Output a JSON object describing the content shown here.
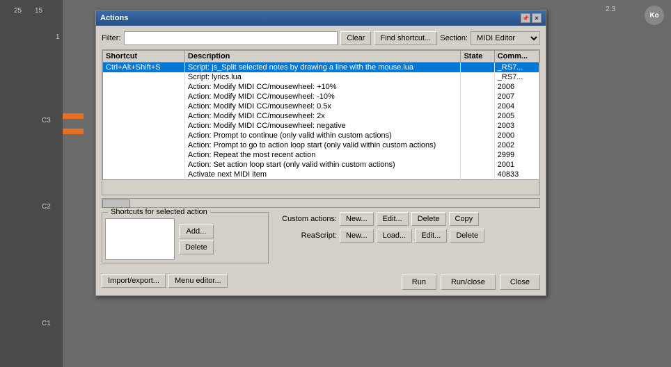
{
  "daw": {
    "markers": {
      "top_left_1": "25",
      "top_left_2": "15",
      "side_num": "1",
      "c3": "C3",
      "c2": "C2",
      "c1": "C1",
      "top_right": "2.3",
      "ko": "Ko"
    }
  },
  "modal": {
    "title": "Actions",
    "filter_label": "Filter:",
    "filter_value": "",
    "clear_label": "Clear",
    "find_shortcut_label": "Find shortcut...",
    "section_label": "Section:",
    "section_value": "MIDI Editor",
    "columns": {
      "shortcut": "Shortcut",
      "description": "Description",
      "state": "State",
      "command": "Comm..."
    },
    "rows": [
      {
        "shortcut": "Ctrl+Alt+Shift+S",
        "description": "Script: js_Split selected notes by drawing a line with the mouse.lua",
        "state": "",
        "command": "_RS7..."
      },
      {
        "shortcut": "",
        "description": "Script: lyrics.lua",
        "state": "",
        "command": "_RS7..."
      },
      {
        "shortcut": "",
        "description": "Action: Modify MIDI CC/mousewheel: +10%",
        "state": "",
        "command": "2006"
      },
      {
        "shortcut": "",
        "description": "Action: Modify MIDI CC/mousewheel: -10%",
        "state": "",
        "command": "2007"
      },
      {
        "shortcut": "",
        "description": "Action: Modify MIDI CC/mousewheel: 0.5x",
        "state": "",
        "command": "2004"
      },
      {
        "shortcut": "",
        "description": "Action: Modify MIDI CC/mousewheel: 2x",
        "state": "",
        "command": "2005"
      },
      {
        "shortcut": "",
        "description": "Action: Modify MIDI CC/mousewheel: negative",
        "state": "",
        "command": "2003"
      },
      {
        "shortcut": "",
        "description": "Action: Prompt to continue (only valid within custom actions)",
        "state": "",
        "command": "2000"
      },
      {
        "shortcut": "",
        "description": "Action: Prompt to go to action loop start (only valid within custom actions)",
        "state": "",
        "command": "2002"
      },
      {
        "shortcut": "",
        "description": "Action: Repeat the most recent action",
        "state": "",
        "command": "2999"
      },
      {
        "shortcut": "",
        "description": "Action: Set action loop start (only valid within custom actions)",
        "state": "",
        "command": "2001"
      },
      {
        "shortcut": "",
        "description": "Activate next MIDI item",
        "state": "",
        "command": "40833"
      }
    ],
    "shortcuts_section_label": "Shortcuts for selected action",
    "add_label": "Add...",
    "delete_label": "Delete",
    "custom_actions_label": "Custom actions:",
    "reascript_label": "ReaScript:",
    "new_label_1": "New...",
    "edit_label_1": "Edit...",
    "delete_label_1": "Delete",
    "copy_label": "Copy",
    "new_label_2": "New...",
    "load_label": "Load...",
    "edit_label_2": "Edit...",
    "delete_label_2": "Delete",
    "import_export_label": "Import/export...",
    "menu_editor_label": "Menu editor...",
    "run_label": "Run",
    "run_close_label": "Run/close",
    "close_label": "Close"
  }
}
